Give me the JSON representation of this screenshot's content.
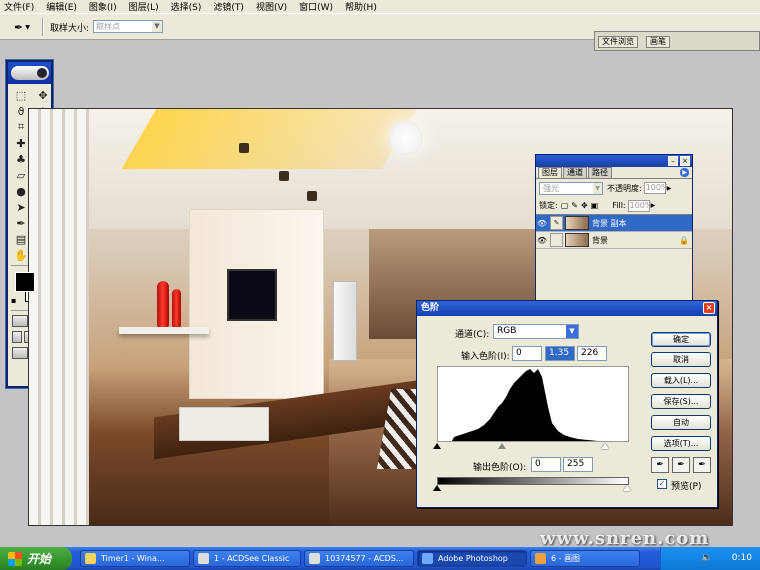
{
  "menubar": [
    "文件(F)",
    "编辑(E)",
    "图象(I)",
    "图层(L)",
    "选择(S)",
    "滤镜(T)",
    "视图(V)",
    "窗口(W)",
    "帮助(H)"
  ],
  "options": {
    "sample_label": "取样大小:",
    "sample_value": "取样点"
  },
  "palette_well": {
    "tab1": "文件浏览",
    "tab2": "画笔"
  },
  "layers": {
    "tabs": [
      "图层",
      "通道",
      "路径"
    ],
    "blend_mode": "强光",
    "opacity_label": "不透明度:",
    "opacity_value": "100%",
    "lock_label": "锁定:",
    "fill_label": "Fill:",
    "fill_value": "100%",
    "items": [
      {
        "name": "背景 副本",
        "selected": true
      },
      {
        "name": "背景",
        "selected": false
      }
    ]
  },
  "levels": {
    "title": "色阶",
    "channel_label": "通道(C):",
    "channel_value": "RGB",
    "input_label": "输入色阶(I):",
    "input_black": "0",
    "input_gamma": "1.35",
    "input_white": "226",
    "output_label": "输出色阶(O):",
    "output_black": "0",
    "output_white": "255",
    "buttons": [
      "确定",
      "取消",
      "载入(L)...",
      "保存(S)...",
      "自动",
      "选项(T)..."
    ],
    "preview_label": "预览(P)",
    "preview_checked": true
  },
  "taskbar": {
    "start": "开始",
    "tasks": [
      {
        "label": "Timer1 - Wina...",
        "active": false
      },
      {
        "label": "1 - ACDSee Classic",
        "active": false
      },
      {
        "label": "10374577 - ACDS...",
        "active": false
      },
      {
        "label": "Adobe Photoshop",
        "active": true
      },
      {
        "label": "6 - 画图",
        "active": false
      }
    ],
    "clock": "0:10"
  },
  "watermark": "www.snren.com"
}
